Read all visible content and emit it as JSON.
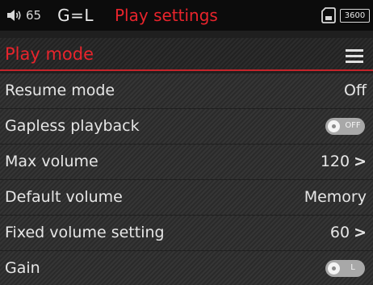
{
  "status_bar": {
    "volume": "65",
    "gain": "G=L",
    "title": "Play settings",
    "battery": "3600"
  },
  "menu": {
    "title": "Play mode"
  },
  "settings": [
    {
      "label": "Resume mode",
      "value": "Off"
    },
    {
      "label": "Gapless playback",
      "toggle": "OFF"
    },
    {
      "label": "Max volume",
      "value": "120",
      "chevron": ">"
    },
    {
      "label": "Default volume",
      "value": "Memory"
    },
    {
      "label": "Fixed volume setting",
      "value": "60",
      "chevron": ">"
    },
    {
      "label": "Gain",
      "toggle": "L"
    }
  ],
  "colors": {
    "accent": "#e8242c",
    "background": "#1f1f1f",
    "toggle_track": "#a8a8a8"
  },
  "icons": [
    "speaker-icon",
    "sd-card-icon",
    "battery-icon",
    "hamburger-menu-icon",
    "chevron-right-icon"
  ]
}
